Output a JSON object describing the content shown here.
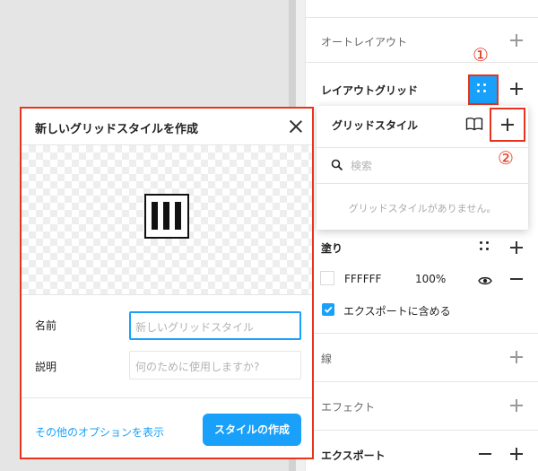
{
  "panel": {
    "auto_layout": {
      "title": "オートレイアウト"
    },
    "layout_grid": {
      "title": "レイアウトグリッド"
    },
    "fill": {
      "title": "塗り",
      "hex": "FFFFFF",
      "opacity": "100%"
    },
    "export_checkbox": {
      "label": "エクスポートに含める",
      "checked": true
    },
    "stroke": {
      "title": "線"
    },
    "effects": {
      "title": "エフェクト"
    },
    "export": {
      "title": "エクスポート"
    }
  },
  "popover": {
    "title": "グリッドスタイル",
    "search_placeholder": "検索",
    "empty_message": "グリッドスタイルがありません。"
  },
  "annotations": {
    "step1": "①",
    "step2": "②"
  },
  "dialog": {
    "title": "新しいグリッドスタイルを作成",
    "name_label": "名前",
    "name_placeholder": "新しいグリッドスタイル",
    "description_label": "説明",
    "description_placeholder": "何のために使用しますか?",
    "more_options_link": "その他のオプションを表示",
    "create_button": "スタイルの作成"
  },
  "colors": {
    "accent": "#18a0fb",
    "highlight": "#e8341c"
  },
  "icons": [
    "close-icon",
    "grid-style-icon",
    "library-book-icon",
    "search-icon",
    "plus-icon",
    "minus-icon",
    "eye-icon",
    "check-icon"
  ]
}
